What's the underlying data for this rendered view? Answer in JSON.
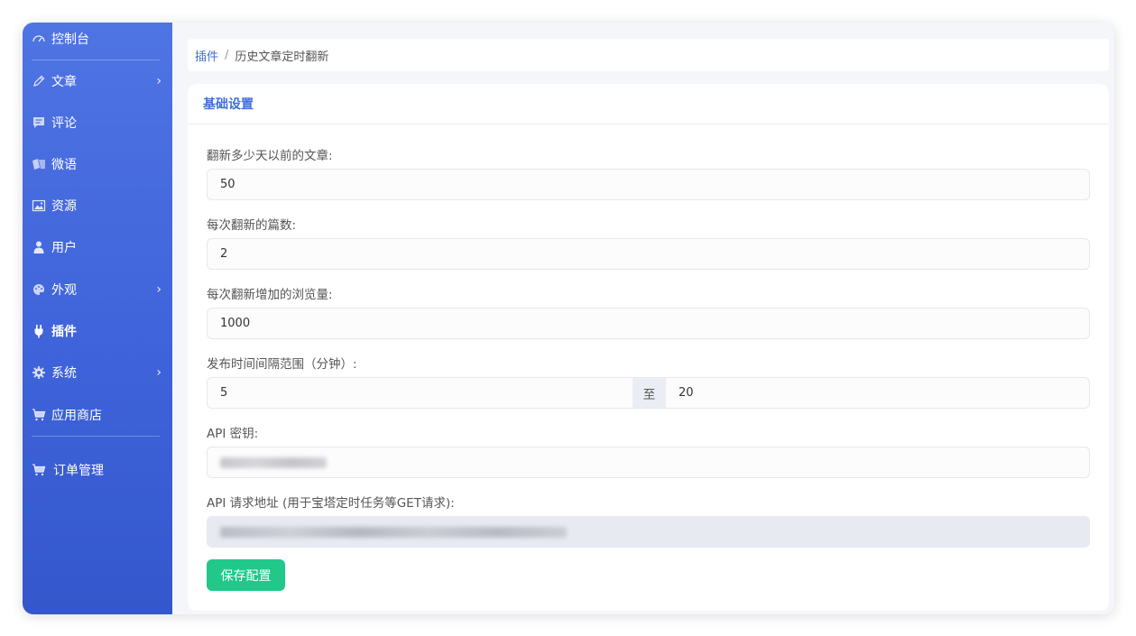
{
  "sidebar": {
    "items": [
      {
        "label": "控制台",
        "icon": "dashboard-icon"
      },
      {
        "label": "文章",
        "icon": "pencil-icon",
        "has_submenu": true
      },
      {
        "label": "评论",
        "icon": "comment-icon"
      },
      {
        "label": "微语",
        "icon": "cards-icon"
      },
      {
        "label": "资源",
        "icon": "image-icon"
      },
      {
        "label": "用户",
        "icon": "user-icon"
      },
      {
        "label": "外观",
        "icon": "palette-icon",
        "has_submenu": true
      },
      {
        "label": "插件",
        "icon": "plug-icon",
        "active": true
      },
      {
        "label": "系统",
        "icon": "gear-icon",
        "has_submenu": true
      },
      {
        "label": "应用商店",
        "icon": "cart-icon"
      },
      {
        "label": "订单管理",
        "icon": "cart-icon"
      }
    ],
    "chevron": "›"
  },
  "breadcrumb": {
    "parent": "插件",
    "separator": "/",
    "current": "历史文章定时翻新"
  },
  "card": {
    "title": "基础设置",
    "fields": {
      "days": {
        "label": "翻新多少天以前的文章:",
        "value": "50"
      },
      "count": {
        "label": "每次翻新的篇数:",
        "value": "2"
      },
      "views": {
        "label": "每次翻新增加的浏览量:",
        "value": "1000"
      },
      "interval": {
        "label": "发布时间间隔范围（分钟）:",
        "min": "5",
        "separator": "至",
        "max": "20"
      },
      "api_key": {
        "label": "API 密钥:",
        "value_obscured": true
      },
      "api_url": {
        "label": "API 请求地址 (用于宝塔定时任务等GET请求):",
        "value_obscured": true,
        "readonly": true
      }
    },
    "save_label": "保存配置"
  },
  "colors": {
    "sidebar_top": "#4f74e3",
    "sidebar_bottom": "#3457cc",
    "accent": "#3f6fd9",
    "save_button": "#21c88a"
  }
}
